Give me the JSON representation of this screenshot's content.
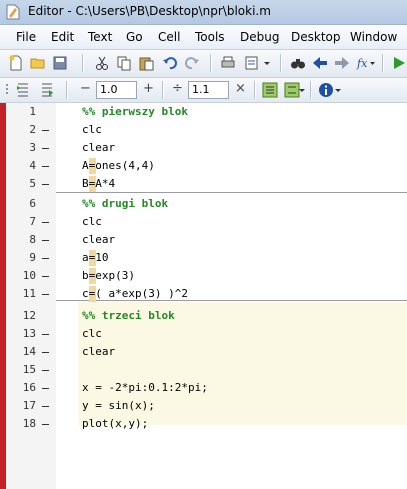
{
  "window": {
    "title": "Editor - C:\\Users\\PB\\Desktop\\npr\\bloki.m"
  },
  "menu": [
    "File",
    "Edit",
    "Text",
    "Go",
    "Cell",
    "Tools",
    "Debug",
    "Desktop",
    "Window"
  ],
  "toolbar2": {
    "minus": "−",
    "value1": "1.0",
    "plus": "+",
    "divide": "÷",
    "value2": "1.1",
    "times": "×"
  },
  "lines": [
    {
      "n": "1",
      "text": "%% pierwszy blok",
      "comment": true
    },
    {
      "n": "2",
      "text": "clc"
    },
    {
      "n": "3",
      "text": "clear"
    },
    {
      "n": "4",
      "text": "A=ones(4,4)",
      "mark": true
    },
    {
      "n": "5",
      "text": "B=A*4",
      "mark": true
    },
    {
      "n": "6",
      "text": "%% drugi blok",
      "comment": true
    },
    {
      "n": "7",
      "text": "clc"
    },
    {
      "n": "8",
      "text": "clear"
    },
    {
      "n": "9",
      "text": "a=10",
      "mark": true
    },
    {
      "n": "10",
      "text": "b=exp(3)",
      "mark": true
    },
    {
      "n": "11",
      "text": "c=( a*exp(3) )^2",
      "mark": true
    },
    {
      "n": "12",
      "text": "%% trzeci blok",
      "comment": true
    },
    {
      "n": "13",
      "text": "clc"
    },
    {
      "n": "14",
      "text": "clear"
    },
    {
      "n": "15",
      "text": ""
    },
    {
      "n": "16",
      "text": "x = -2*pi:0.1:2*pi;"
    },
    {
      "n": "17",
      "text": "y = sin(x);"
    },
    {
      "n": "18",
      "text": "plot(x,y);"
    }
  ],
  "colors": {
    "comment": "#228b22",
    "current_cell": "#fbf9e3",
    "error_strip": "#c22126"
  }
}
